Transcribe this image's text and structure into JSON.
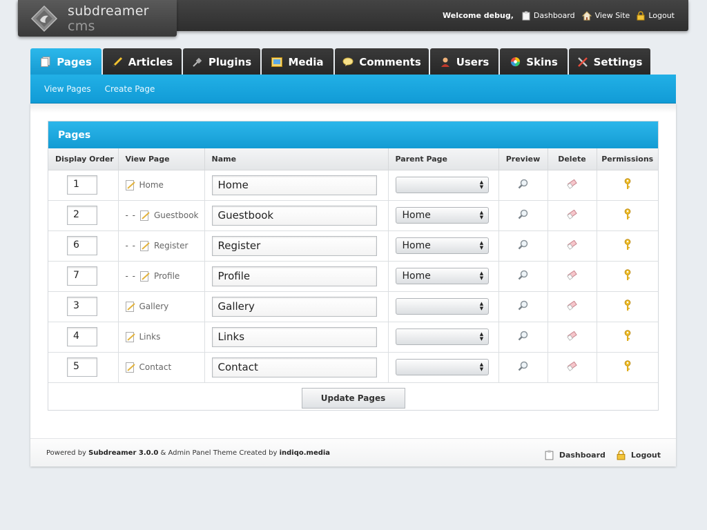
{
  "header": {
    "logo_main": "subdreamer",
    "logo_suffix": " cms",
    "welcome": "Welcome debug,",
    "links": [
      {
        "label": "Dashboard",
        "icon": "clipboard-icon"
      },
      {
        "label": "View Site",
        "icon": "house-icon"
      },
      {
        "label": "Logout",
        "icon": "lock-icon"
      }
    ]
  },
  "tabs": [
    {
      "label": "Pages",
      "icon": "pages-icon",
      "active": true
    },
    {
      "label": "Articles",
      "icon": "pencil-icon"
    },
    {
      "label": "Plugins",
      "icon": "plug-icon"
    },
    {
      "label": "Media",
      "icon": "media-icon"
    },
    {
      "label": "Comments",
      "icon": "speech-bubble-icon"
    },
    {
      "label": "Users",
      "icon": "user-icon"
    },
    {
      "label": "Skins",
      "icon": "color-wheel-icon"
    },
    {
      "label": "Settings",
      "icon": "tools-icon"
    }
  ],
  "subnav": {
    "view_pages": "View Pages",
    "create_page": "Create Page"
  },
  "box_title": "Pages",
  "columns": [
    "Display Order",
    "View Page",
    "Name",
    "Parent Page",
    "Preview",
    "Delete",
    "Permissions"
  ],
  "rows": [
    {
      "order": "1",
      "view": "Home",
      "indent": "",
      "name": "Home",
      "parent": ""
    },
    {
      "order": "2",
      "view": "Guestbook",
      "indent": "- -",
      "name": "Guestbook",
      "parent": "Home"
    },
    {
      "order": "6",
      "view": "Register",
      "indent": "- -",
      "name": "Register",
      "parent": "Home"
    },
    {
      "order": "7",
      "view": "Profile",
      "indent": "- -",
      "name": "Profile",
      "parent": "Home"
    },
    {
      "order": "3",
      "view": "Gallery",
      "indent": "",
      "name": "Gallery",
      "parent": ""
    },
    {
      "order": "4",
      "view": "Links",
      "indent": "",
      "name": "Links",
      "parent": ""
    },
    {
      "order": "5",
      "view": "Contact",
      "indent": "",
      "name": "Contact",
      "parent": ""
    }
  ],
  "update_button": "Update Pages",
  "footer": {
    "powered_prefix": "Powered by ",
    "powered_name": "Subdreamer 3.0.0",
    "middle": " & Admin Panel Theme Created by ",
    "theme_author": "indiqo.media",
    "dashboard": "Dashboard",
    "logout": "Logout"
  },
  "colors": {
    "accent": "#1aa8e0",
    "dark": "#2e2e2e",
    "background": "#e9edf1"
  }
}
